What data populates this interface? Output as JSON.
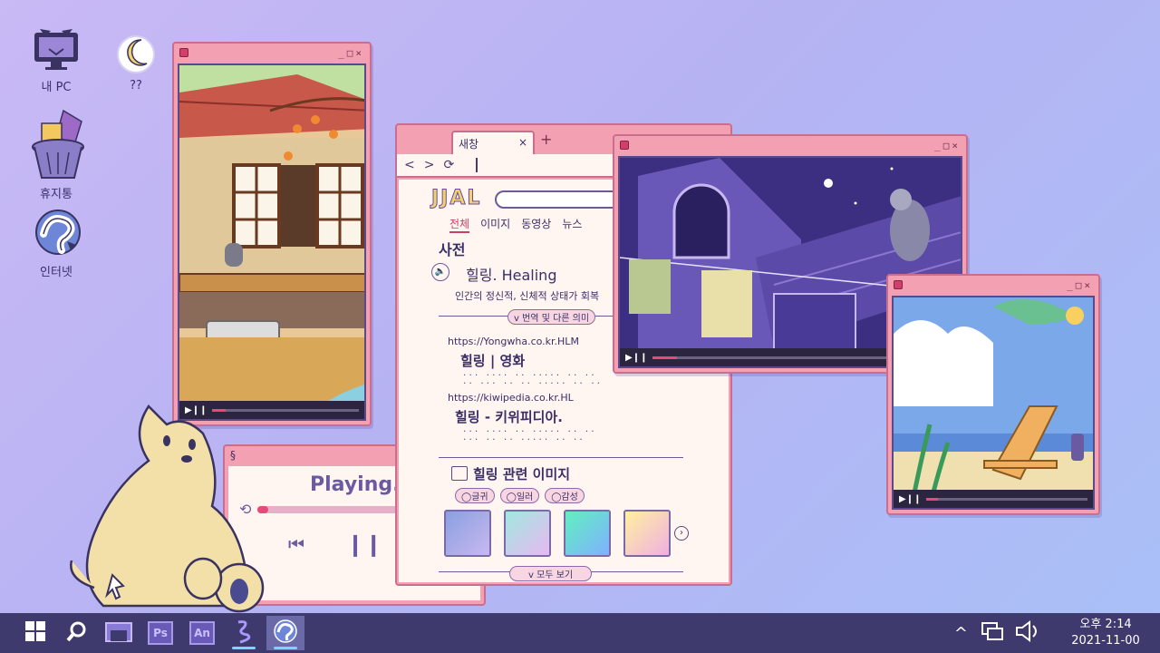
{
  "desktop": {
    "icons": [
      {
        "label": "내 PC",
        "icon": "monitor-cat-icon"
      },
      {
        "label": "??",
        "icon": "moon-icon"
      },
      {
        "label": "휴지통",
        "icon": "trash-icon"
      },
      {
        "label": "인터넷",
        "icon": "internet-icon"
      }
    ]
  },
  "windows": {
    "window_controls": "_□×",
    "house_video": {
      "progress_percent": 9
    },
    "night_video": {
      "progress_percent": 8
    },
    "beach_video": {
      "progress_percent": 7
    }
  },
  "browser": {
    "tab_label": "새창",
    "tab_close": "×",
    "new_tab": "+",
    "logo": "JJAL",
    "nav": {
      "back": "<",
      "forward": ">",
      "reload": "⟳"
    },
    "search_tabs": [
      "전체",
      "이미지",
      "동영상",
      "뉴스"
    ],
    "dictionary": {
      "heading": "사전",
      "word": "힐링.  Healing",
      "definition": "인간의 정신적, 신체적 상태가 회복",
      "more_button": "번역 및 다른 의미"
    },
    "results": [
      {
        "url": "https://Yongwha.co.kr.HLM",
        "title": "힐링  |  영화",
        "snippet": "... .... .. ..... .. ..\n.. ... .. .. ..... .. .."
      },
      {
        "url": "https://kiwipedia.co.kr.HL",
        "title": "힐링 - 키위피디아.",
        "snippet": "... .... .. ..... .. ..\n... .. .. ..... .. .."
      }
    ],
    "images_section": {
      "heading": "힐링 관련 이미지",
      "filters": [
        "글귀",
        "일러",
        "감성"
      ],
      "see_all": "모두 보기"
    }
  },
  "music": {
    "status": "Playing.",
    "progress_percent": 5
  },
  "taskbar": {
    "apps": [
      {
        "name": "start-button",
        "icon": "windows-icon"
      },
      {
        "name": "search-button",
        "icon": "search-icon"
      },
      {
        "name": "file-explorer",
        "icon": "folder-icon"
      },
      {
        "name": "photoshop",
        "label": "Ps"
      },
      {
        "name": "animate",
        "label": "An"
      },
      {
        "name": "app-squiggle",
        "icon": "squiggle-icon"
      },
      {
        "name": "browser",
        "icon": "internet-icon"
      }
    ],
    "clock": {
      "time": "오후 2:14",
      "date": "2021-11-00"
    }
  },
  "colors": {
    "window_pink": "#f2a0b2",
    "window_border": "#c86f8f",
    "taskbar": "#3e3a6e",
    "accent": "#e8487a"
  }
}
